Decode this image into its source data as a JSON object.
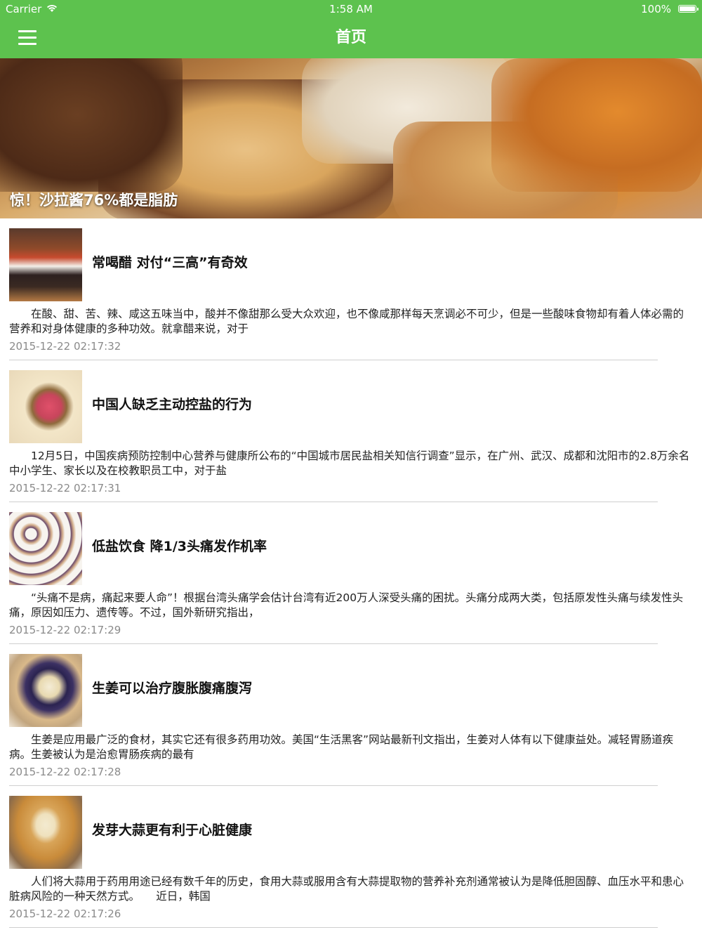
{
  "status_bar": {
    "carrier": "Carrier",
    "time": "1:58 AM",
    "battery": "100%",
    "battery_level": 1.0
  },
  "nav": {
    "title": "首页",
    "menu_icon": "hamburger-menu-icon"
  },
  "banner": {
    "title": "惊！沙拉酱76%都是脂肪"
  },
  "articles": [
    {
      "title": "常喝醋 对付“三高”有奇效",
      "summary": "　　在酸、甜、苦、辣、咸这五味当中，酸并不像甜那么受大众欢迎，也不像咸那样每天烹调必不可少，但是一些酸味食物却有着人体必需的营养和对身体健康的多种功效。就拿醋来说，对于",
      "time": "2015-12-22 02:17:32"
    },
    {
      "title": "中国人缺乏主动控盐的行为",
      "summary": "　　12月5日，中国疾病预防控制中心营养与健康所公布的“中国城市居民盐相关知信行调查”显示，在广州、武汉、成都和沈阳市的2.8万余名中小学生、家长以及在校教职员工中，对于盐",
      "time": "2015-12-22 02:17:31"
    },
    {
      "title": "低盐饮食 降1/3头痛发作机率",
      "summary": "　　“头痛不是病，痛起来要人命”！根据台湾头痛学会估计台湾有近200万人深受头痛的困扰。头痛分成两大类，包括原发性头痛与续发性头痛，原因如压力、遗传等。不过，国外新研究指出，",
      "time": "2015-12-22 02:17:29"
    },
    {
      "title": "生姜可以治疗腹胀腹痛腹泻",
      "summary": "　　生姜是应用最广泛的食材，其实它还有很多药用功效。美国“生活黑客”网站最新刊文指出，生姜对人体有以下健康益处。减轻胃肠道疾病。生姜被认为是治愈胃肠疾病的最有",
      "time": "2015-12-22 02:17:28"
    },
    {
      "title": "发芽大蒜更有利于心脏健康",
      "summary": "　　人们将大蒜用于药用用途已经有数千年的历史，食用大蒜或服用含有大蒜提取物的营养补充剂通常被认为是降低胆固醇、血压水平和患心脏病风险的一种天然方式。　　近日，韩国",
      "time": "2015-12-22 02:17:26"
    }
  ],
  "colors": {
    "nav_green": "#5dc24e",
    "time_gray": "#8a8a8a",
    "divider": "#cfcfcf"
  }
}
